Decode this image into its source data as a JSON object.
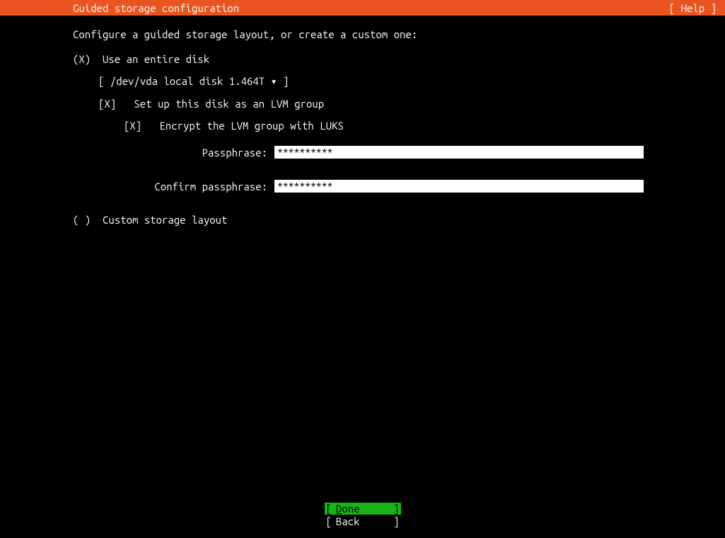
{
  "header": {
    "title": "Guided storage configuration",
    "help": "[ Help ]"
  },
  "instruction": "Configure a guided storage layout, or create a custom one:",
  "options": {
    "entire_disk": {
      "marker": "(X)",
      "label": "Use an entire disk"
    },
    "custom": {
      "marker": "( )",
      "label": "Custom storage layout"
    }
  },
  "disk_selector": {
    "text": "[ /dev/vda local disk 1.464T ▾ ]"
  },
  "lvm": {
    "marker": "[X]",
    "label": "Set up this disk as an LVM group"
  },
  "encrypt": {
    "marker": "[X]",
    "label": "Encrypt the LVM group with LUKS"
  },
  "passphrase": {
    "label": "Passphrase:",
    "value": "**********"
  },
  "confirm_passphrase": {
    "label": "Confirm passphrase:",
    "value": "**********"
  },
  "buttons": {
    "done_label": "Done",
    "back_label": "Back"
  }
}
